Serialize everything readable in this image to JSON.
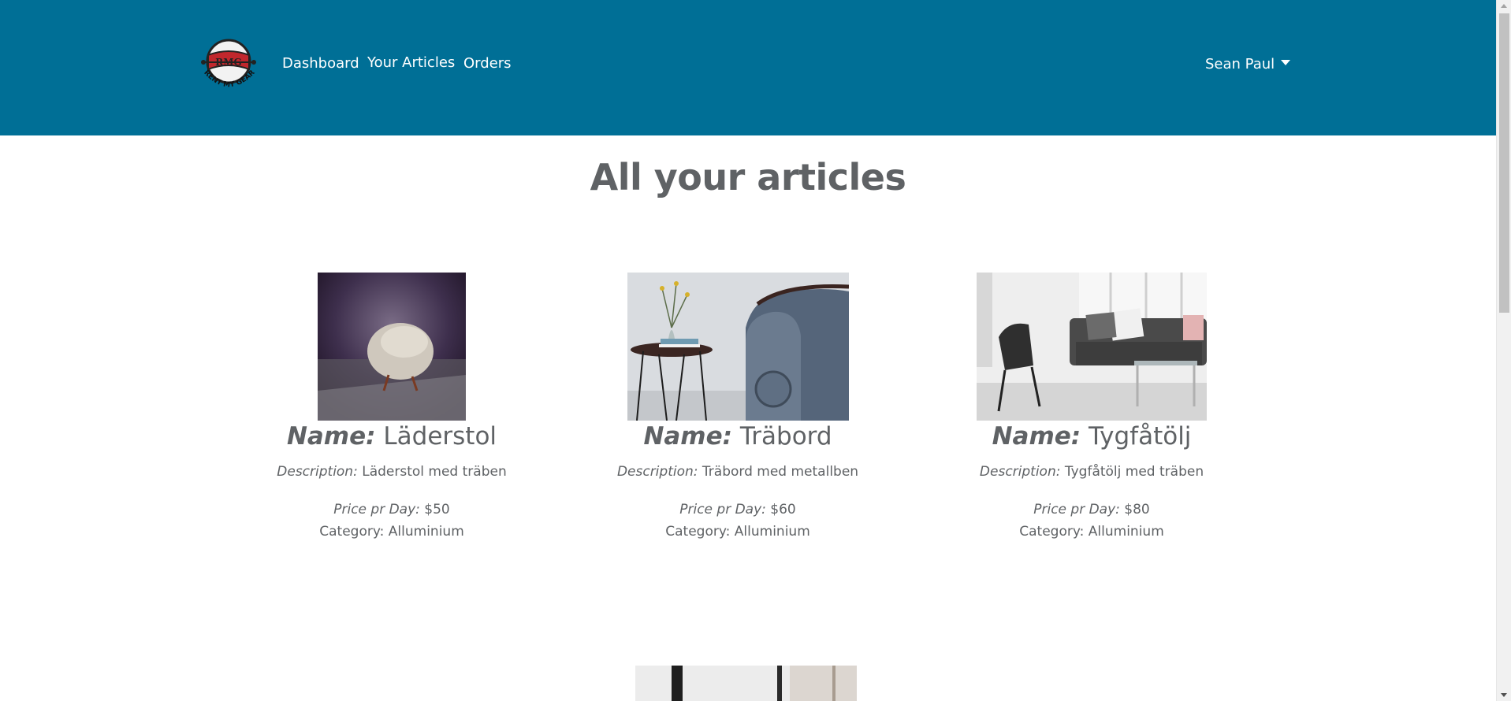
{
  "navbar": {
    "logo_text": "RMG",
    "logo_subtext": "RENT MY GEAR",
    "links": [
      {
        "label": "Dashboard"
      },
      {
        "label": "Your Articles"
      },
      {
        "label": "Orders"
      }
    ],
    "user": {
      "name": "Sean Paul"
    },
    "colors": {
      "background": "#006f96",
      "text": "#ffffff"
    }
  },
  "page": {
    "title": "All your articles"
  },
  "articles": [
    {
      "name_label": "Name:",
      "name": "Läderstol",
      "description_label": "Description:",
      "description": "Läderstol med träben",
      "price_label": "Price pr Day:",
      "price": "$50",
      "category": "Category: Alluminium"
    },
    {
      "name_label": "Name:",
      "name": "Träbord",
      "description_label": "Description:",
      "description": "Träbord med metallben",
      "price_label": "Price pr Day:",
      "price": "$60",
      "category": "Category: Alluminium"
    },
    {
      "name_label": "Name:",
      "name": "Tygfåtölj",
      "description_label": "Description:",
      "description": "Tygfåtölj med träben",
      "price_label": "Price pr Day:",
      "price": "$80",
      "category": "Category: Alluminium"
    }
  ]
}
